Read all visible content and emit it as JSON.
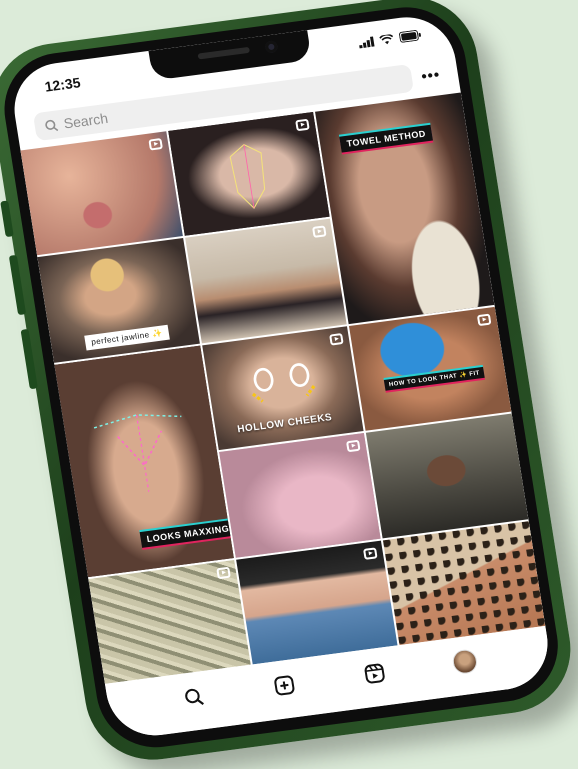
{
  "status_bar": {
    "time": "12:35"
  },
  "search": {
    "placeholder": "Search",
    "more_label": "•••"
  },
  "tiles": [
    {
      "id": "face-lips",
      "caption": ""
    },
    {
      "id": "face-mapping-woman",
      "caption": ""
    },
    {
      "id": "towel-method",
      "caption": "TOWEL METHOD"
    },
    {
      "id": "perfect-jawline",
      "caption": "perfect jawline ✨"
    },
    {
      "id": "beach-body",
      "caption": ""
    },
    {
      "id": "looks-maxxing",
      "caption": "LOOKS MAXXING"
    },
    {
      "id": "hollow-cheeks",
      "caption": "HOLLOW CHEEKS"
    },
    {
      "id": "blue-top",
      "caption": "HOW TO LOOK THAT ✨ FIT"
    },
    {
      "id": "injection",
      "caption": ""
    },
    {
      "id": "gym-mirror",
      "caption": ""
    },
    {
      "id": "money-pile",
      "caption": ""
    },
    {
      "id": "jeans-waist",
      "caption": ""
    },
    {
      "id": "leopard-print",
      "caption": ""
    }
  ],
  "tab_bar": {
    "items": [
      "search-tab",
      "create-tab",
      "reels-tab",
      "profile-tab"
    ]
  },
  "colors": {
    "phone_green": "#1d3f1b",
    "background": "#dcebd9",
    "caption_accent": "#e0245e"
  }
}
